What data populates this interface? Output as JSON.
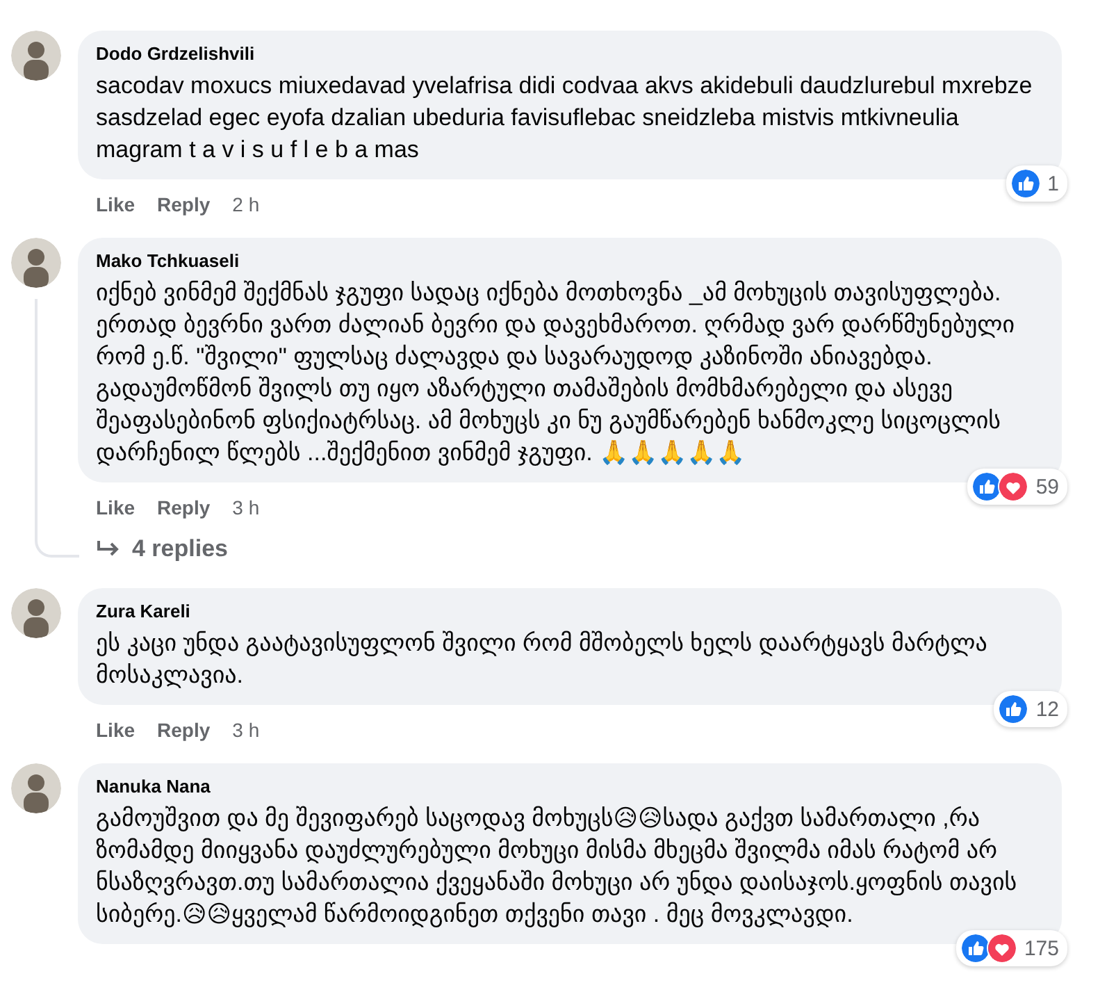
{
  "comments": [
    {
      "author": "Dodo Grdzelishvili",
      "text": "sacodav moxucs miuxedavad yvelafrisa didi codvaa akvs akidebuli daudzlurebul mxrebze sasdzelad egec eyofa dzalian ubeduria favisuflebac sneidzleba mistvis mtkivneulia magram t a v i s u f l e b a mas",
      "actions": [
        "Like",
        "Reply"
      ],
      "time": "2 h",
      "reactions": [
        {
          "kind": "like"
        }
      ],
      "count": "1",
      "thread": false
    },
    {
      "author": "Mako Tchkuaseli",
      "text": "იქნებ ვინმემ შექმნას ჯგუფი სადაც იქნება მოთხოვნა _ამ მოხუცის თავისუფლება. ერთად ბევრნი ვართ ძალიან ბევრი და დავეხმაროთ. ღრმად ვარ დარწმუნებული რომ ე.წ. \"შვილი\" ფულსაც ძალავდა და სავარაუდოდ კაზინოში ანიავებდა. გადაუმოწმონ შვილს თუ იყო აზარტული თამაშების მომხმარებელი და ასევე შეაფასებინონ ფსიქიატრსაც. ამ მოხუცს კი ნუ გაუმწარებენ ხანმოკლე სიცოცლის დარჩენილ წლებს ...შექმენით ვინმემ ჯგუფი. 🙏🙏🙏🙏🙏",
      "actions": [
        "Like",
        "Reply"
      ],
      "time": "3 h",
      "reactions": [
        {
          "kind": "like"
        },
        {
          "kind": "love"
        }
      ],
      "count": "59",
      "thread": true,
      "replies": "4 replies"
    },
    {
      "author": "Zura Kareli",
      "text": "ეს კაცი უნდა გაატავისუფლონ შვილი რომ მშობელს ხელს დაარტყავს მარტლა მოსაკლავია.",
      "actions": [
        "Like",
        "Reply"
      ],
      "time": "3 h",
      "reactions": [
        {
          "kind": "like"
        }
      ],
      "count": "12",
      "thread": false
    },
    {
      "author": "Nanuka Nana",
      "text": "გამოუშვით და მე შევიფარებ საცოდავ მოხუცს😥😥სადა გაქვთ სამართალი ,რა ზომამდე მიიყვანა დაუძლურებული მოხუცი მისმა მხეცმა შვილმა იმას რატომ არ ნსაზღვრავთ.თუ სამართალია ქვეყანაში მოხუცი არ უნდა დაისაჯოს.ყოფნის თავის სიბერე.😥😥ყველამ წარმოიდგინეთ თქვენი თავი . მეც მოვკლავდი.",
      "reactions": [
        {
          "kind": "like"
        },
        {
          "kind": "love"
        }
      ],
      "count": "175",
      "thread": false
    }
  ]
}
